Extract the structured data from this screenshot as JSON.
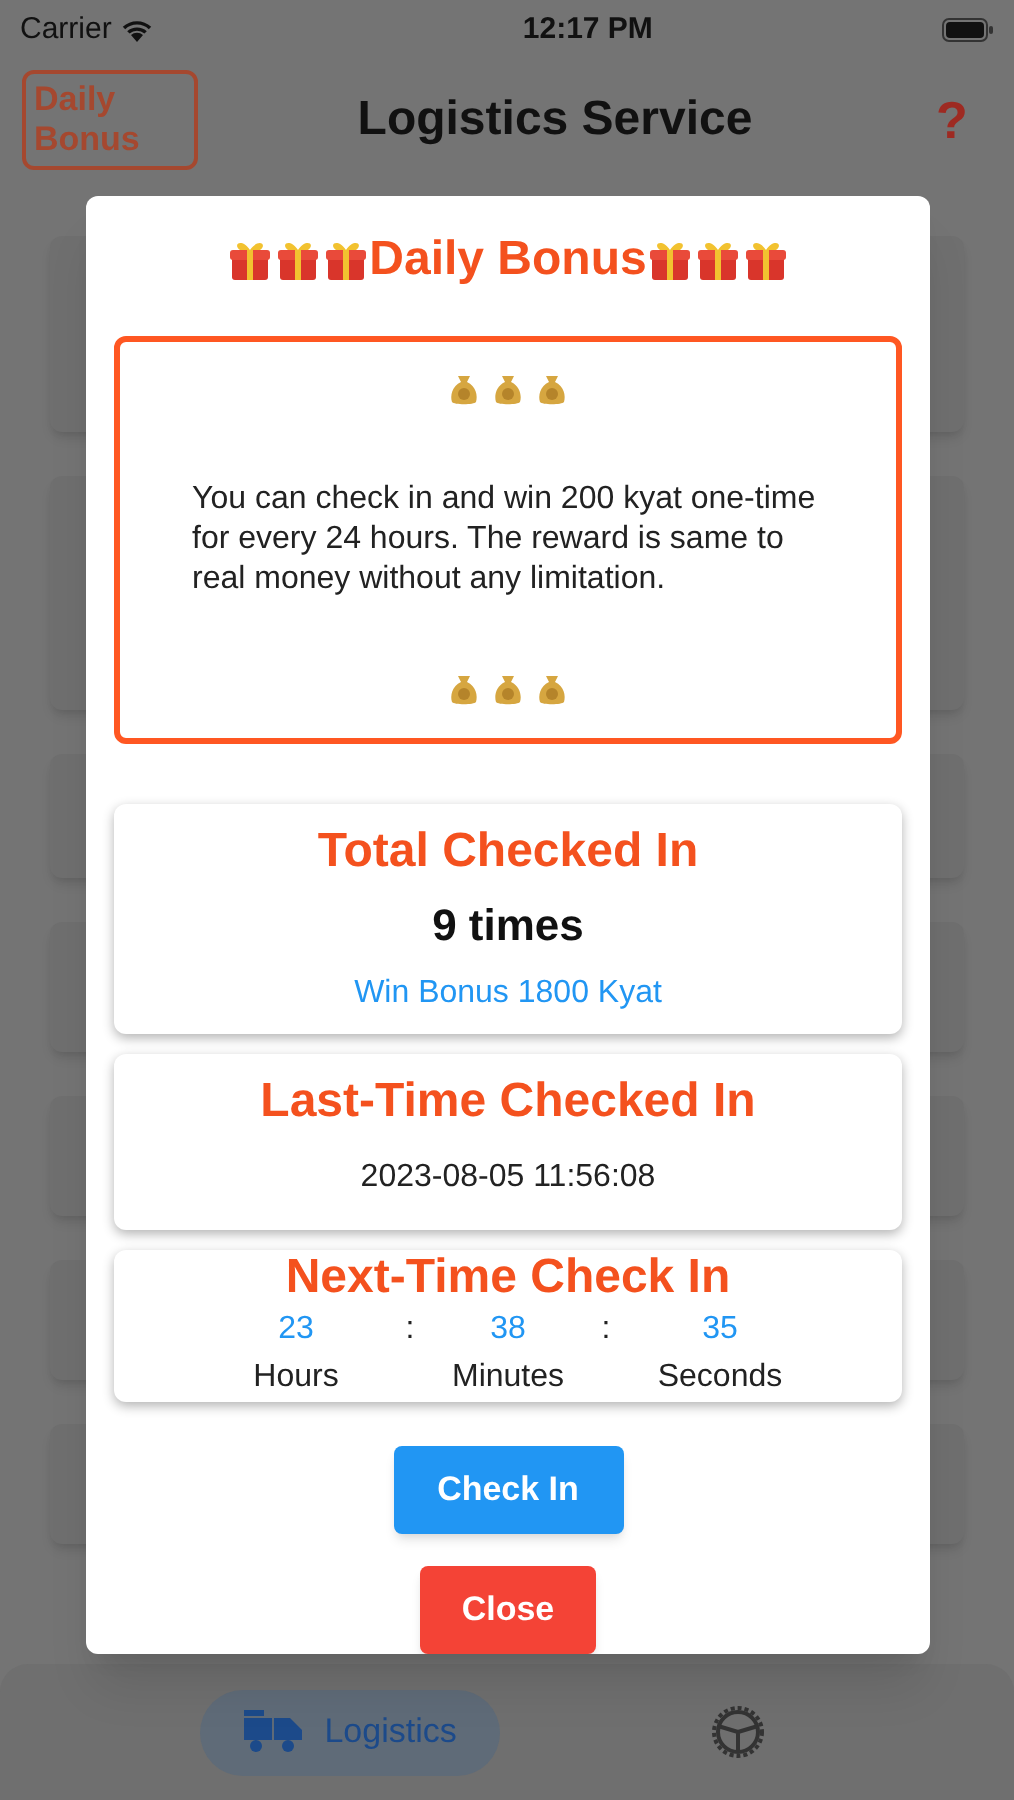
{
  "status_bar": {
    "carrier": "Carrier",
    "time": "12:17 PM"
  },
  "header": {
    "bonus_button": "Daily Bonus",
    "title": "Logistics Service",
    "help": "?"
  },
  "dialog": {
    "title": "Daily Bonus",
    "notice": "You can check in and win 200 kyat one-time for every 24 hours. The reward is same to real money without any limitation.",
    "cards": [
      {
        "kind": "total",
        "title": "Total Checked In",
        "value": "9 times",
        "note": "Win Bonus 1800 Kyat"
      },
      {
        "kind": "last",
        "title": "Last-Time Checked In",
        "value": "2023-08-05 11:56:08"
      },
      {
        "kind": "countdown",
        "title": "Next-Time Check In",
        "separators": [
          ":",
          ":"
        ],
        "units": [
          {
            "value": "23",
            "label": "Hours"
          },
          {
            "value": "38",
            "label": "Minutes"
          },
          {
            "value": "35",
            "label": "Seconds"
          }
        ]
      }
    ],
    "buttons": [
      {
        "kind": "primary",
        "label": "Check In"
      },
      {
        "kind": "danger",
        "label": "Close"
      }
    ]
  },
  "tabs": [
    {
      "kind": "logistics",
      "label": "Logistics",
      "selected": true
    },
    {
      "kind": "settings",
      "selected": false
    }
  ]
}
